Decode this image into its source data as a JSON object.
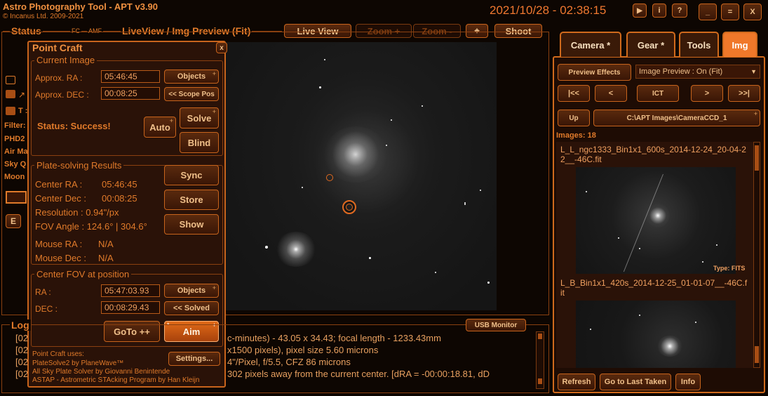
{
  "app": {
    "title": "Astro Photography Tool  -  APT v3.90",
    "copyright": "© Incanus Ltd. 2009-2021",
    "datetime": "2021/10/28 - 02:38:15",
    "window_buttons": {
      "play": "▶",
      "info": "i",
      "help": "?",
      "minimize": "_",
      "maximize": "=",
      "close": "X"
    }
  },
  "status_bar": {
    "status_label": "Status",
    "fc": "FC",
    "amf": "AMF",
    "liveview_label": "LiveView / Img Preview (Fit)",
    "live_view": "Live View",
    "zoom_in": "Zoom +",
    "zoom_out": "Zoom -",
    "crosshair": "⌖",
    "shoot": "Shoot"
  },
  "left_status": {
    "filter": "Filter:",
    "phd2": "PHD2",
    "air_mass": "Air Ma",
    "sky_quality": "Sky Q",
    "moon": "Moon",
    "t_label": "T :",
    "e_button": "E"
  },
  "point_craft": {
    "title": "Point Craft",
    "close": "x",
    "current_image": {
      "legend": "Current Image",
      "ra_label": "Approx. RA :",
      "ra_value": "05:46:45",
      "dec_label": "Approx. DEC :",
      "dec_value": "00:08:25",
      "objects": "Objects",
      "scope_pos": "<< Scope Pos",
      "status": "Status: Success!",
      "auto": "Auto",
      "solve": "Solve",
      "blind": "Blind"
    },
    "results": {
      "legend": "Plate-solving Results",
      "center_ra_label": "Center RA :",
      "center_ra_value": "05:46:45",
      "center_dec_label": "Center Dec :",
      "center_dec_value": "00:08:25",
      "resolution": "Resolution : 0.94\"/px",
      "fov_angle": "FOV Angle : 124.6° | 304.6°",
      "mouse_ra_label": "Mouse RA :",
      "mouse_ra_value": "N/A",
      "mouse_dec_label": "Mouse Dec :",
      "mouse_dec_value": "N/A",
      "sync": "Sync",
      "store": "Store",
      "show": "Show"
    },
    "center_fov": {
      "legend": "Center FOV at position",
      "ra_label": "RA :",
      "ra_value": "05:47:03.93",
      "dec_label": "DEC :",
      "dec_value": "00:08:29.43",
      "objects": "Objects",
      "solved": "<< Solved",
      "goto": "GoTo ++",
      "aim": "Aim"
    },
    "uses_title": "Point Craft uses:",
    "uses": [
      "PlateSolve2 by PlaneWave™",
      "All Sky Plate Solver by Giovanni Benintende",
      "ASTAP - Astrometric STAcking Program by Han Kleijn"
    ],
    "settings": "Settings..."
  },
  "log": {
    "label": "Log",
    "usb_monitor": "USB Monitor",
    "prefixes": [
      "[02",
      "[02",
      "[02",
      "[02"
    ],
    "lines": [
      "c-minutes) - 43.05 x 34.43; focal length - 1233.43mm",
      "x1500 pixels), pixel size 5.60 microns",
      "4\"/Pixel, f/5.5, CFZ 86 microns",
      "302 pixels away from the current center. [dRA = -00:00:18.81, dD"
    ]
  },
  "right_panel": {
    "tabs": [
      "Camera *",
      "Gear *",
      "Tools",
      "Img"
    ],
    "active_tab": "Img",
    "preview_effects": "Preview Effects",
    "image_preview_select": "Image Preview : On (Fit)",
    "nav": {
      "first": "|<<",
      "prev": "<",
      "ict": "ICT",
      "next": ">",
      "last": ">>|"
    },
    "up": "Up",
    "path": "C:\\APT Images\\CameraCCD_1",
    "images_count": "Images: 18",
    "thumbnails": [
      {
        "name": "L_L_ngc1333_Bin1x1_600s_2014-12-24_20-04-22__-46C.fit",
        "type": "Type: FITS"
      },
      {
        "name": "L_B_Bin1x1_420s_2014-12-25_01-01-07__-46C.fit",
        "type": ""
      }
    ],
    "refresh": "Refresh",
    "go_to_last": "Go to Last Taken",
    "info": "Info"
  },
  "colors": {
    "accent": "#e07a2a",
    "background": "#0d0602",
    "panel": "#2a1208",
    "highlight": "#f0782a"
  }
}
